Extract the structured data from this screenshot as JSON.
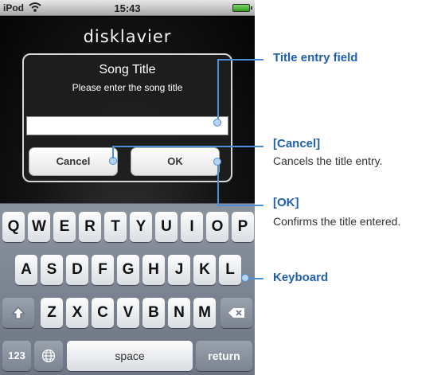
{
  "status_bar": {
    "carrier": "iPod",
    "time": "15:43"
  },
  "app": {
    "logo": "disklavier"
  },
  "dialog": {
    "title": "Song Title",
    "message": "Please enter the song title",
    "input_value": "",
    "cancel_label": "Cancel",
    "ok_label": "OK"
  },
  "keyboard": {
    "row1": [
      "Q",
      "W",
      "E",
      "R",
      "T",
      "Y",
      "U",
      "I",
      "O",
      "P"
    ],
    "row2": [
      "A",
      "S",
      "D",
      "F",
      "G",
      "H",
      "J",
      "K",
      "L"
    ],
    "row3": [
      "Z",
      "X",
      "C",
      "V",
      "B",
      "N",
      "M"
    ],
    "numbers_label": "123",
    "space_label": "space",
    "return_label": "return"
  },
  "callouts": {
    "title_field": "Title entry field",
    "cancel_title": "[Cancel]",
    "cancel_desc": "Cancels the title entry.",
    "ok_title": "[OK]",
    "ok_desc": "Confirms the title entered.",
    "keyboard": "Keyboard"
  },
  "colors": {
    "callout_blue": "#1f5fb0",
    "leader_blue": "#4a8fd8"
  }
}
